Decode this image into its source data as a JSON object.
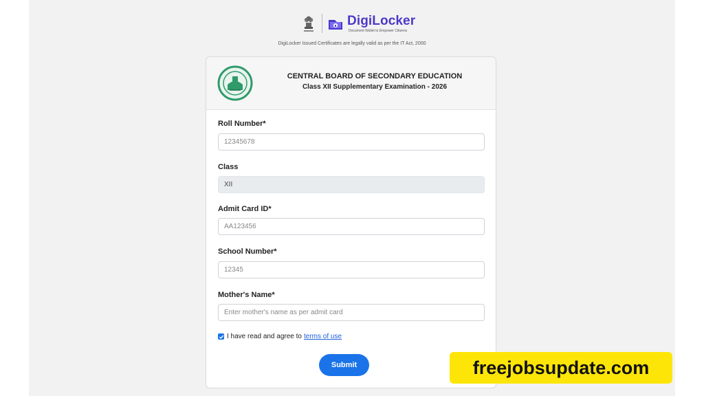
{
  "header": {
    "brand_name": "DigiLocker",
    "brand_tagline": "Document Wallet to Empower Citizens",
    "legal_note": "DigiLocker Issued Certificates are legally valid as per the IT Act, 2000"
  },
  "card": {
    "board_title": "CENTRAL BOARD OF SECONDARY EDUCATION",
    "exam_title": "Class XII Supplementary Examination - 2026"
  },
  "form": {
    "roll_number": {
      "label": "Roll Number*",
      "placeholder": "12345678",
      "value": ""
    },
    "class": {
      "label": "Class",
      "value": "XII"
    },
    "admit_card_id": {
      "label": "Admit Card ID*",
      "placeholder": "AA123456",
      "value": ""
    },
    "school_number": {
      "label": "School Number*",
      "placeholder": "12345",
      "value": ""
    },
    "mothers_name": {
      "label": "Mother's Name*",
      "placeholder": "Enter mother's name as per admit card",
      "value": ""
    },
    "agree_text": "I have read and agree to",
    "terms_link": "terms of use",
    "agree_checked": true,
    "submit_label": "Submit"
  },
  "watermark": {
    "text": "freejobsupdate.com"
  },
  "colors": {
    "brand": "#4b39c8",
    "primary": "#1a73e8",
    "watermark_bg": "#fde508"
  },
  "icons": {
    "emblem": "national-emblem-icon",
    "digilocker": "digilocker-logo-icon",
    "cbse": "cbse-logo-icon",
    "checkbox": "checkmark-icon"
  }
}
